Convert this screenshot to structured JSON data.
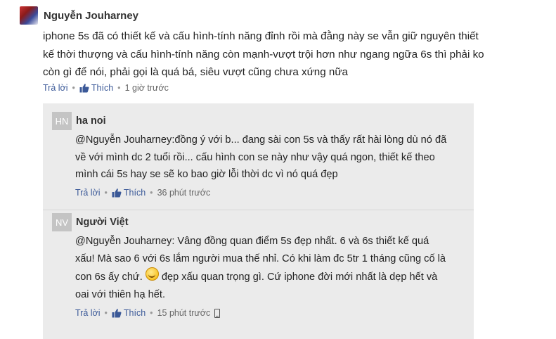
{
  "comment": {
    "author": "Nguyễn Jouharney",
    "text": "iphone 5s đã có thiết kế và cấu hình-tính năng đỉnh rồi mà đằng này se vẫn giữ nguyên thiết kế thời thượng và cấu hình-tính năng còn mạnh-vượt trội hơn như ngang ngữa 6s thì phải ko còn gì để nói, phải gọi là quá bá, siêu vượt cũng chưa xứng nữa",
    "reply_label": "Trả lời",
    "like_label": "Thích",
    "time": "1 giờ trước"
  },
  "replies": [
    {
      "initials": "HN",
      "author": "ha noi",
      "text": "@Nguyễn Jouharney:đồng ý với b... đang sài con 5s và thấy rất hài lòng dù nó đã về với mình dc 2 tuổi rồi... cấu hình con se này như vậy quá ngon, thiết kế theo mình cái 5s hay se sẽ ko bao giờ lỗi thời dc vì nó quá đẹp",
      "reply_label": "Trả lời",
      "like_label": "Thích",
      "time": "36 phút trước"
    },
    {
      "initials": "NV",
      "author": "Người Việt",
      "text_before_emoji": "@Nguyễn Jouharney: Vâng đồng quan điểm 5s đẹp nhất. 6 và 6s thiết kế quá xấu! Mà sao 6 với 6s lắm người mua thế nhỉ. Có khi làm đc 5tr 1 tháng cũng cố là con 6s ấy chứ. ",
      "text_after_emoji": " đẹp xấu quan trọng gì. Cứ iphone đời mới nhất là dẹp hết và oai với thiên hạ hết.",
      "emoji_icon": "smile-emoji-icon",
      "reply_label": "Trả lời",
      "like_label": "Thích",
      "time": "15 phút trước",
      "device_icon": "mobile-phone-icon"
    }
  ],
  "colors": {
    "link": "#3b5998",
    "reply_bg": "#ebebeb",
    "initials_bg": "#c4c4c4",
    "meta_text": "#666666"
  }
}
